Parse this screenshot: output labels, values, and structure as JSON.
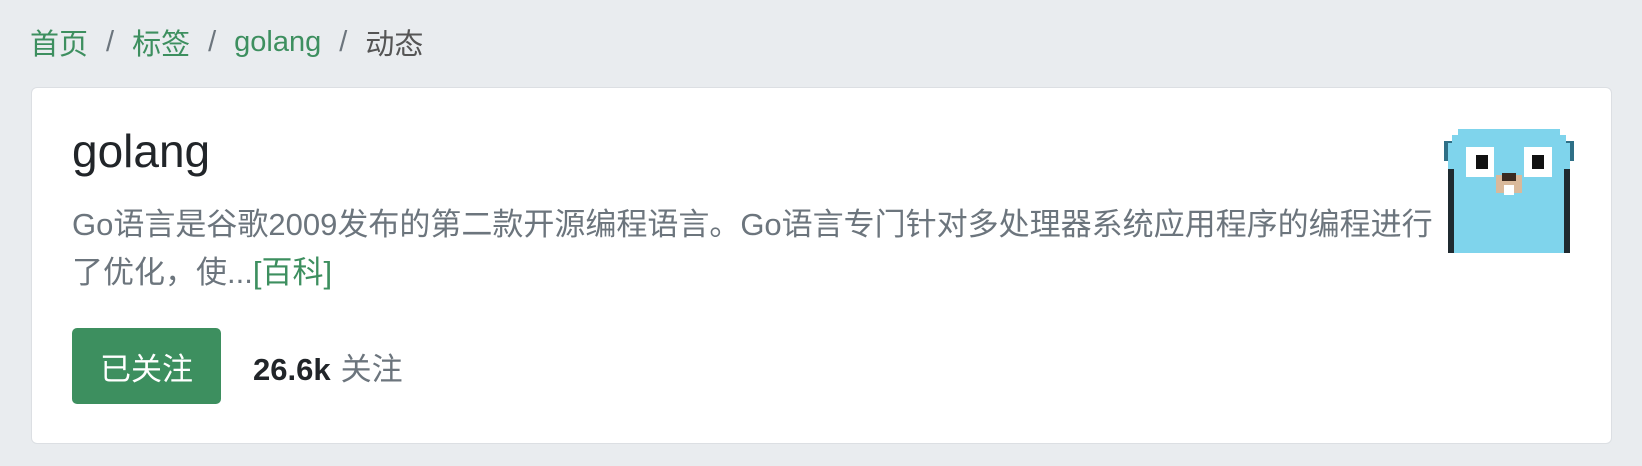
{
  "breadcrumb": {
    "home": "首页",
    "tags": "标签",
    "tag": "golang",
    "current": "动态",
    "separator": "/"
  },
  "tag": {
    "name": "golang",
    "description": "Go语言是谷歌2009发布的第二款开源编程语言。Go语言专门针对多处理器系统应用程序的编程进行了优化，使...",
    "wiki_link": "[百科]",
    "follow_button": "已关注",
    "follower_count": "26.6k",
    "follower_label": "关注",
    "avatar_icon": "gopher-icon"
  },
  "colors": {
    "accent": "#3d8f5f",
    "background": "#e9ecef",
    "card": "#ffffff",
    "muted_text": "#6c757d",
    "gopher": "#7fd4ec"
  }
}
